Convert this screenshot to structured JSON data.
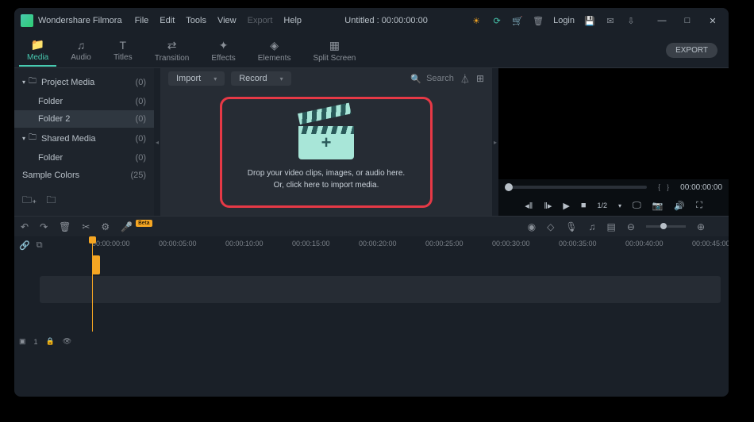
{
  "titlebar": {
    "app_name": "Wondershare Filmora",
    "menu": {
      "file": "File",
      "edit": "Edit",
      "tools": "Tools",
      "view": "View",
      "export": "Export",
      "help": "Help"
    },
    "center_title": "Untitled : 00:00:00:00",
    "login": "Login"
  },
  "tabs": {
    "media": "Media",
    "audio": "Audio",
    "titles": "Titles",
    "transition": "Transition",
    "effects": "Effects",
    "elements": "Elements",
    "split": "Split Screen",
    "export_btn": "EXPORT"
  },
  "sidebar": {
    "items": [
      {
        "label": "Project Media",
        "count": "(0)"
      },
      {
        "label": "Folder",
        "count": "(0)"
      },
      {
        "label": "Folder 2",
        "count": "(0)"
      },
      {
        "label": "Shared Media",
        "count": "(0)"
      },
      {
        "label": "Folder",
        "count": "(0)"
      },
      {
        "label": "Sample Colors",
        "count": "(25)"
      }
    ]
  },
  "media_toolbar": {
    "import": "Import",
    "record": "Record",
    "search": "Search"
  },
  "dropzone": {
    "line1": "Drop your video clips, images, or audio here.",
    "line2": "Or, click here to import media."
  },
  "preview": {
    "ratio": "1/2",
    "timecode": "00:00:00:00"
  },
  "toolbar2": {
    "beta": "Beta"
  },
  "ruler": {
    "ticks": [
      "00:00:00:00",
      "00:00:05:00",
      "00:00:10:00",
      "00:00:15:00",
      "00:00:20:00",
      "00:00:25:00",
      "00:00:30:00",
      "00:00:35:00",
      "00:00:40:00",
      "00:00:45:00"
    ]
  },
  "track_label": "1"
}
